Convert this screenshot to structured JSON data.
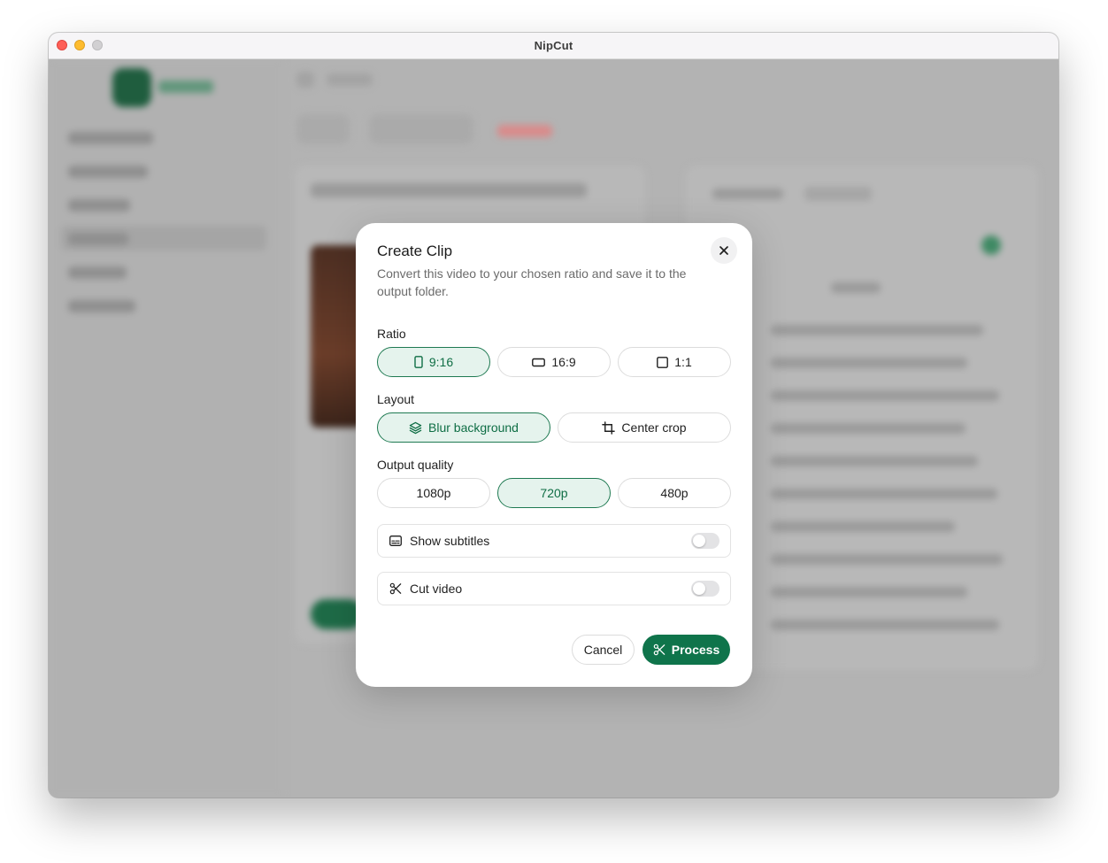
{
  "window": {
    "title": "NipCut"
  },
  "dialog": {
    "title": "Create Clip",
    "description": "Convert this video to your chosen ratio and save it to the output folder.",
    "ratio": {
      "label": "Ratio",
      "options": [
        {
          "label": "9:16",
          "icon": "portrait-ratio-icon",
          "selected": true
        },
        {
          "label": "16:9",
          "icon": "landscape-ratio-icon",
          "selected": false
        },
        {
          "label": "1:1",
          "icon": "square-ratio-icon",
          "selected": false
        }
      ]
    },
    "layout": {
      "label": "Layout",
      "options": [
        {
          "label": "Blur background",
          "icon": "layers-icon",
          "selected": true
        },
        {
          "label": "Center crop",
          "icon": "crop-icon",
          "selected": false
        }
      ]
    },
    "quality": {
      "label": "Output quality",
      "options": [
        {
          "label": "1080p",
          "selected": false
        },
        {
          "label": "720p",
          "selected": true
        },
        {
          "label": "480p",
          "selected": false
        }
      ]
    },
    "toggles": [
      {
        "label": "Show subtitles",
        "icon": "subtitles-icon",
        "on": false
      },
      {
        "label": "Cut video",
        "icon": "scissors-icon",
        "on": false
      }
    ],
    "cancel_label": "Cancel",
    "process_label": "Process"
  },
  "colors": {
    "accent": "#0f744b",
    "accent_light": "#e5f3ed",
    "overlay": "#b3b3b3"
  }
}
